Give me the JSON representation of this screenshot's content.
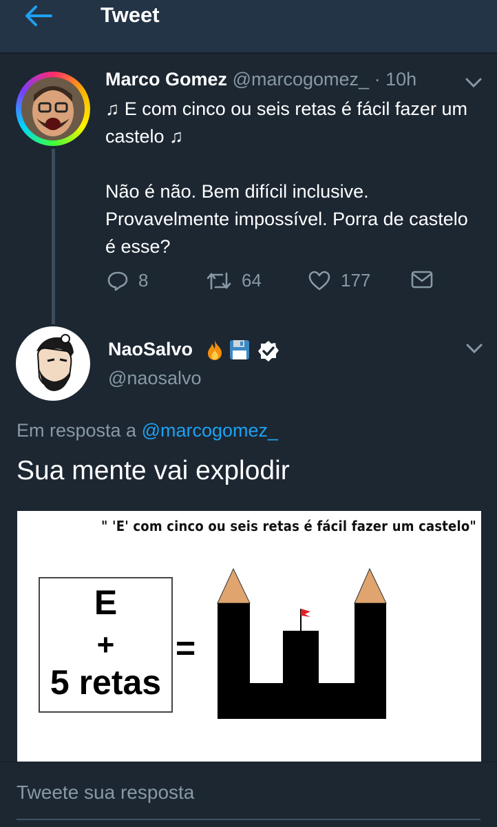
{
  "header": {
    "title": "Tweet",
    "back_icon": "arrow-left-icon"
  },
  "colors": {
    "background": "#1c2732",
    "header": "#243447",
    "accent": "#1da1f2",
    "muted": "#8899a6"
  },
  "parent_tweet": {
    "name": "Marco Gomez",
    "handle": "@marcogomez_",
    "separator": "·",
    "time": "10h",
    "text_lines": [
      "♫ E com cinco ou seis retas é fácil fazer um castelo ♫",
      "Não é não. Bem difícil inclusive. Provavelmente impossível. Porra de castelo é esse?"
    ],
    "replies": "8",
    "retweets": "64",
    "likes": "177"
  },
  "reply_tweet": {
    "name": "NaoSalvo",
    "emojis": [
      "fire-emoji",
      "floppy-disk-emoji",
      "verified-badge"
    ],
    "handle": "@naosalvo",
    "reply_prefix": "Em resposta a",
    "reply_handle": "@marcogomez_",
    "text": "Sua mente vai explodir",
    "media": {
      "caption": "\" 'E' com cinco ou seis retas é fácil fazer um castelo\"",
      "box_letter": "E",
      "box_plus": "+",
      "box_retas": "5 retas",
      "equals": "="
    }
  },
  "compose": {
    "placeholder": "Tweete sua resposta"
  }
}
